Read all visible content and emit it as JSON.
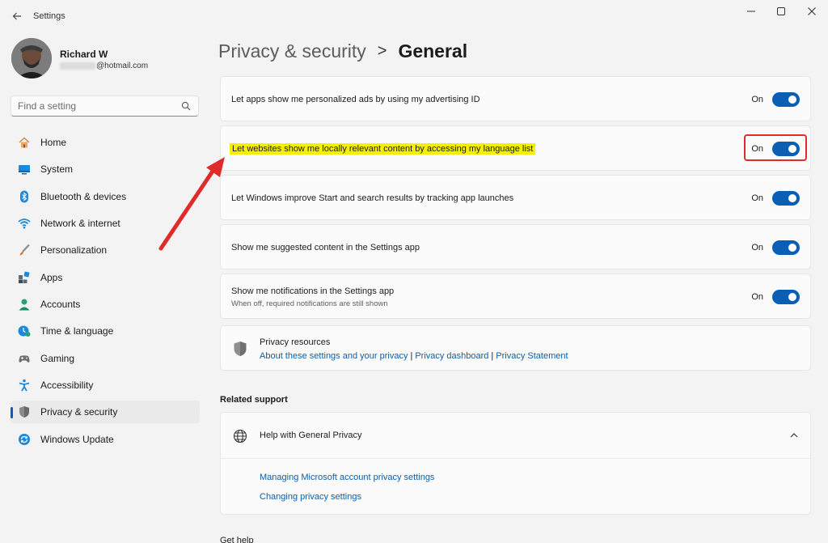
{
  "window": {
    "app_title": "Settings",
    "back_icon": "arrow-left-icon",
    "controls": [
      "minimize-icon",
      "maximize-icon",
      "close-icon"
    ]
  },
  "profile": {
    "name": "Richard W",
    "email_visible": "@hotmail.com"
  },
  "search": {
    "placeholder": "Find a setting",
    "icon": "search-icon"
  },
  "nav": {
    "items": [
      {
        "label": "Home",
        "icon": "home-icon"
      },
      {
        "label": "System",
        "icon": "monitor-icon"
      },
      {
        "label": "Bluetooth & devices",
        "icon": "bluetooth-icon"
      },
      {
        "label": "Network & internet",
        "icon": "wifi-icon"
      },
      {
        "label": "Personalization",
        "icon": "brush-icon"
      },
      {
        "label": "Apps",
        "icon": "apps-icon"
      },
      {
        "label": "Accounts",
        "icon": "person-icon"
      },
      {
        "label": "Time & language",
        "icon": "clock-globe-icon"
      },
      {
        "label": "Gaming",
        "icon": "gamepad-icon"
      },
      {
        "label": "Accessibility",
        "icon": "accessibility-icon"
      },
      {
        "label": "Privacy & security",
        "icon": "shield-icon"
      },
      {
        "label": "Windows Update",
        "icon": "update-icon"
      }
    ],
    "active_label": "Privacy & security"
  },
  "header": {
    "parent": "Privacy & security",
    "separator": ">",
    "current": "General"
  },
  "settings": [
    {
      "label": "Let apps show me personalized ads by using my advertising ID",
      "state": "On"
    },
    {
      "label": "Let websites show me locally relevant content by accessing my language list",
      "state": "On"
    },
    {
      "label": "Let Windows improve Start and search results by tracking app launches",
      "state": "On"
    },
    {
      "label": "Show me suggested content in the Settings app",
      "state": "On"
    },
    {
      "label": "Show me notifications in the Settings app",
      "description": "When off, required notifications are still shown",
      "state": "On"
    }
  ],
  "privacy_resources": {
    "title": "Privacy resources",
    "links": [
      "About these settings and your privacy",
      "Privacy dashboard",
      "Privacy Statement"
    ]
  },
  "related_support": {
    "heading": "Related support",
    "help_title": "Help with General Privacy",
    "links": [
      "Managing Microsoft account privacy settings",
      "Changing privacy settings"
    ]
  },
  "footer": {
    "get_help": "Get help"
  },
  "colors": {
    "accent": "#0a5fb4",
    "highlight": "#f6f000",
    "annotation_red": "#e02b2b"
  }
}
